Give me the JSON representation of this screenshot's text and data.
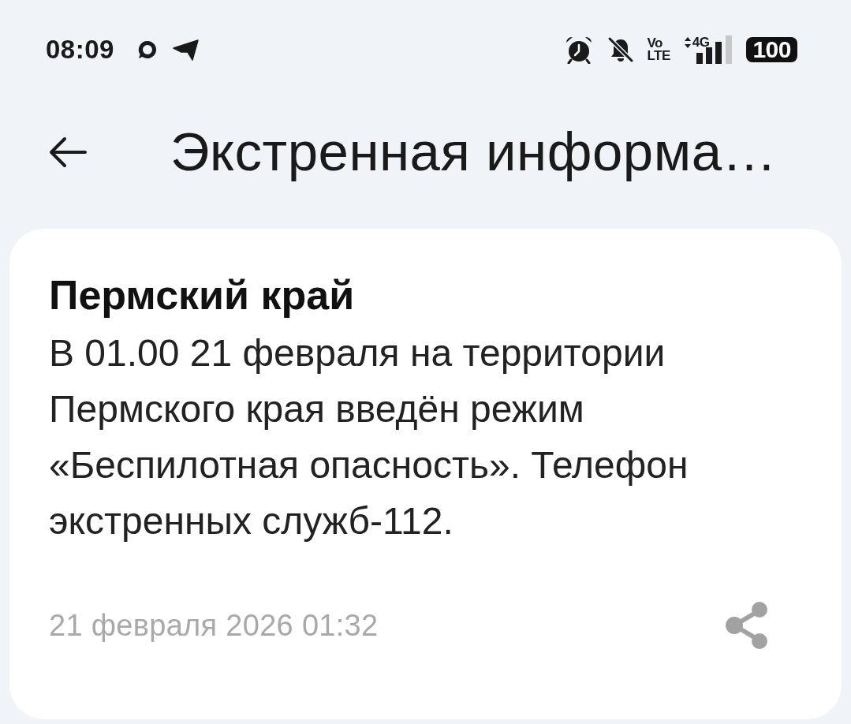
{
  "status_bar": {
    "time": "08:09",
    "volte": {
      "top": "Vo",
      "bottom": "LTE"
    },
    "network_type": "4G",
    "battery": "100"
  },
  "header": {
    "title": "Экстренная информа…"
  },
  "alert": {
    "region": "Пермский край",
    "message": "В 01.00 21 февраля на территории Пермского края введён режим «Беспилотная опасность». Телефон экстренных служб-112.",
    "timestamp": "21 февраля 2026 01:32"
  }
}
